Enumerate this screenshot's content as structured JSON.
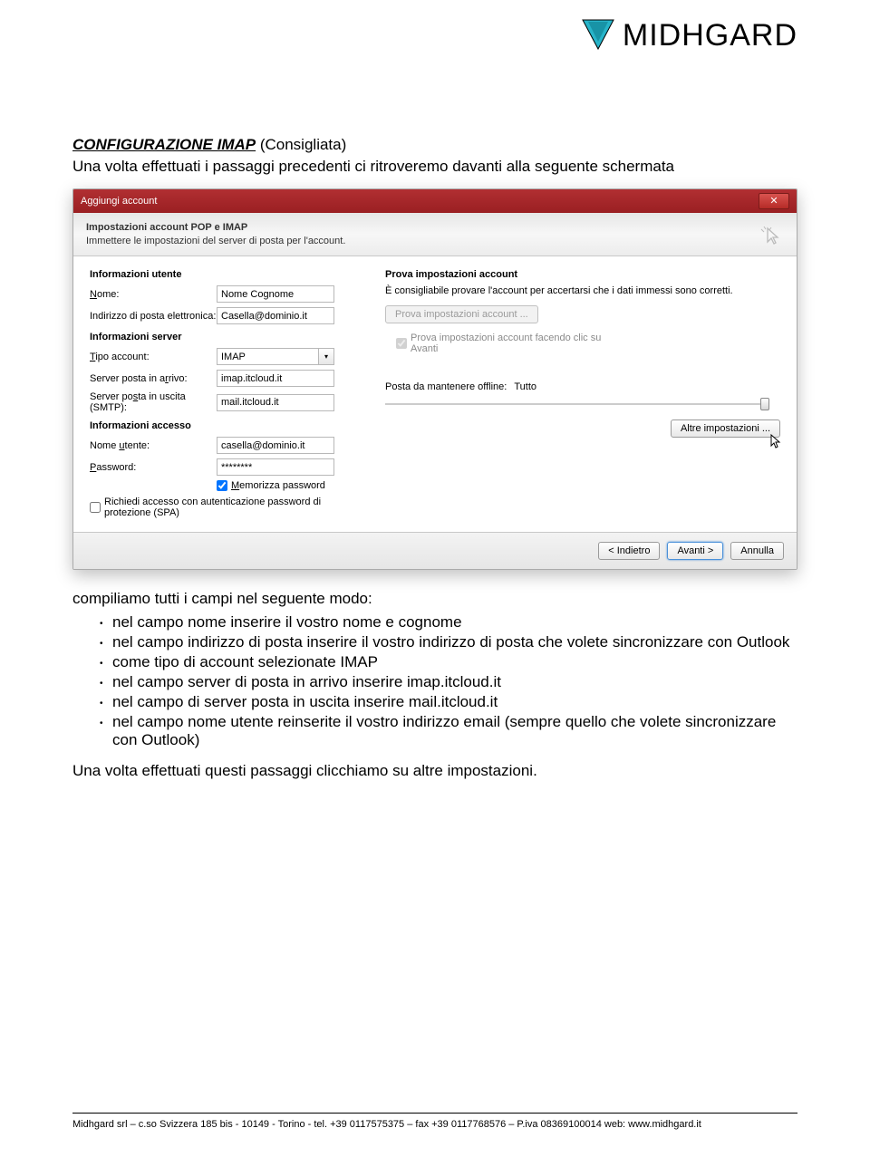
{
  "logo": {
    "text": "MIDHGARD"
  },
  "heading": {
    "title": "CONFIGURAZIONE IMAP",
    "suffix": " (Consigliata)"
  },
  "intro": "Una volta effettuati i passaggi precedenti ci ritroveremo davanti alla seguente schermata",
  "dialog": {
    "title": "Aggiungi account",
    "header_title": "Impostazioni account POP e IMAP",
    "header_sub": "Immettere le impostazioni del server di posta per l'account.",
    "left": {
      "sec_user": "Informazioni utente",
      "name_label": "Nome:",
      "name_value": "Nome Cognome",
      "email_label": "Indirizzo di posta elettronica:",
      "email_value": "Casella@dominio.it",
      "sec_server": "Informazioni server",
      "type_label": "Tipo account:",
      "type_value": "IMAP",
      "in_label": "Server posta in arrivo:",
      "in_value": "imap.itcloud.it",
      "out_label": "Server posta in uscita (SMTP):",
      "out_value": "mail.itcloud.it",
      "sec_access": "Informazioni accesso",
      "user_label": "Nome utente:",
      "user_value": "casella@dominio.it",
      "pass_label": "Password:",
      "pass_value": "********",
      "remember": "Memorizza password",
      "spa": "Richiedi accesso con autenticazione password di protezione (SPA)"
    },
    "right": {
      "sec_test": "Prova impostazioni account",
      "tip": "È consigliabile provare l'account per accertarsi che i dati immessi sono corretti.",
      "test_btn": "Prova impostazioni account ...",
      "auto_test": "Prova impostazioni account facendo clic su Avanti",
      "offline_label": "Posta da mantenere offline:",
      "offline_value": "Tutto",
      "more_btn": "Altre impostazioni ..."
    },
    "footer": {
      "back": "< Indietro",
      "next": "Avanti >",
      "cancel": "Annulla"
    }
  },
  "after_intro": "compiliamo tutti i campi nel seguente modo:",
  "bullets": [
    "nel campo nome inserire il vostro nome e cognome",
    "nel campo indirizzo di posta inserire il vostro indirizzo di posta che volete sincronizzare con Outlook",
    "come tipo di account selezionate IMAP",
    "nel campo server di posta in arrivo inserire imap.itcloud.it",
    "nel campo di server posta in uscita inserire mail.itcloud.it",
    "nel campo nome utente reinserite il vostro indirizzo email (sempre quello che volete sincronizzare con Outlook)"
  ],
  "closing": "Una volta effettuati questi passaggi clicchiamo su altre impostazioni.",
  "footer": "Midhgard srl  –  c.so Svizzera 185 bis  -  10149  - Torino  -  tel. +39 0117575375  –  fax +39 0117768576  –  P.iva 08369100014   web: www.midhgard.it"
}
